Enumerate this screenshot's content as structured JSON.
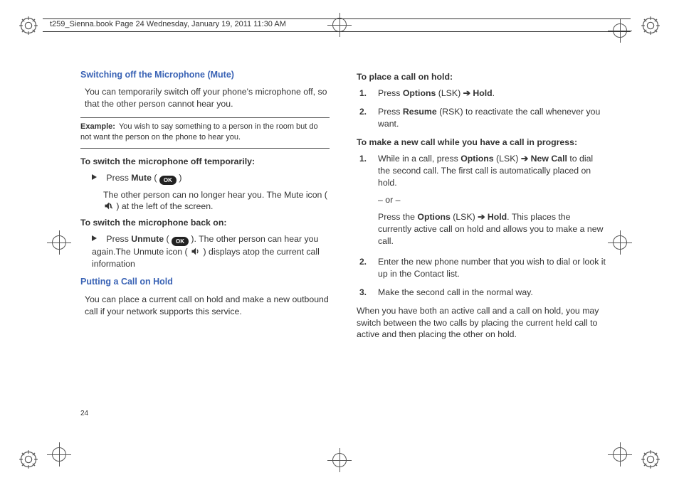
{
  "header": {
    "runningHead": "t259_Sienna.book  Page 24  Wednesday, January 19, 2011  11:30 AM"
  },
  "pageNumber": "24",
  "left": {
    "h1": "Switching off the Microphone (Mute)",
    "p1": "You can temporarily switch off your phone's microphone off, so that the other person cannot hear you.",
    "exampleLabel": "Example:",
    "exampleText": "You wish to say something to a person in the room but do not want the person on the phone to hear you.",
    "sub1": "To switch the microphone off temporarily:",
    "b1a_pre": "Press ",
    "b1a_word": "Mute",
    "b1a_post": " ( ",
    "ok": "OK",
    "b1a_close": " )",
    "b1b": "The other person can no longer hear you. The Mute icon ( ",
    "b1b_post": " ) at the left of the screen.",
    "sub2": "To switch the microphone back on:",
    "b2_pre": "Press ",
    "b2_word": "Unmute",
    "b2_post": " ( ",
    "b2_tail": " ). The other person can hear you again.The Unmute icon ( ",
    "b2_tail2": " ) displays atop the current call information",
    "h2": "Putting a Call on Hold",
    "p2": "You can place a current call on hold and make a new outbound call if your network supports this service."
  },
  "right": {
    "sub1": "To place a call on hold:",
    "s1n1_a": "Press ",
    "s1n1_b": "Options",
    "s1n1_c": " (LSK) ",
    "arrow": "➔",
    "s1n1_d": " Hold",
    "s1n1_e": ".",
    "s1n2_a": "Press ",
    "s1n2_b": "Resume",
    "s1n2_c": " (RSK) to reactivate the call whenever you want.",
    "sub2": "To make a new call while you have a call in progress:",
    "s2n1_a": "While in a call, press ",
    "s2n1_b": "Options",
    "s2n1_c": " (LSK) ",
    "s2n1_d": " New Call",
    "s2n1_e": " to dial the second call. The first call is automatically placed on hold.",
    "s2n1_or": "– or –",
    "s2n1_f": "Press the ",
    "s2n1_g": "Options",
    "s2n1_h": " (LSK) ",
    "s2n1_i": " Hold",
    "s2n1_j": ". This places the currently active call on hold and allows you to make a new call.",
    "s2n2": "Enter the new phone number that you wish to dial or look it up in the Contact list.",
    "s2n3": "Make the second call in the normal way.",
    "p1": "When you have both an active call and a call on hold, you may switch between the two calls by placing the current held call to active and then placing the other on hold."
  },
  "num": {
    "1": "1.",
    "2": "2.",
    "3": "3."
  }
}
